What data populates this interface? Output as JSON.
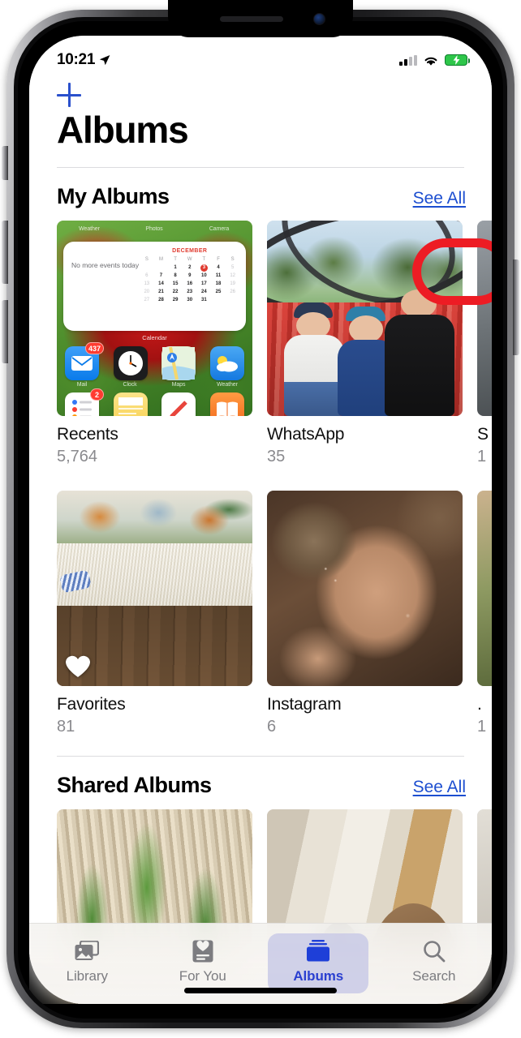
{
  "status_bar": {
    "time": "10:21",
    "location_icon": "location-arrow-icon",
    "cellular_icon": "cellular-signal-icon",
    "wifi_icon": "wifi-icon",
    "battery_icon": "battery-charging-icon"
  },
  "nav": {
    "add_label": "+",
    "add_icon": "plus-icon"
  },
  "header": {
    "title": "Albums"
  },
  "sections": [
    {
      "title": "My Albums",
      "see_all_label": "See All",
      "highlighted": true
    },
    {
      "title": "Shared Albums",
      "see_all_label": "See All",
      "highlighted": false
    }
  ],
  "my_albums": {
    "row1": [
      {
        "name": "Recents",
        "count": "5,764",
        "thumb": "home-screen-screenshot"
      },
      {
        "name": "WhatsApp",
        "count": "35",
        "thumb": "three-people-tulip-garden"
      },
      {
        "name": "S",
        "count": "1",
        "thumb": "partial-photo",
        "partial": true
      }
    ],
    "row2": [
      {
        "name": "Favorites",
        "count": "81",
        "thumb": "dinosaur-fabric-rug-floor",
        "badge_icon": "heart-icon"
      },
      {
        "name": "Instagram",
        "count": "6",
        "thumb": "sepia-closeup"
      },
      {
        "name": ".",
        "count": "1",
        "thumb": "partial-photo",
        "partial": true
      }
    ]
  },
  "shared_albums": [
    {
      "thumb": "garden-mulch-plants"
    },
    {
      "thumb": "indoor-person-doorway"
    },
    {
      "thumb": "partial-photo",
      "partial": true
    }
  ],
  "tabs": [
    {
      "label": "Library",
      "icon": "photo-stack-icon",
      "active": false
    },
    {
      "label": "For You",
      "icon": "heart-card-icon",
      "active": false
    },
    {
      "label": "Albums",
      "icon": "albums-folder-icon",
      "active": true
    },
    {
      "label": "Search",
      "icon": "search-icon",
      "active": false
    }
  ],
  "widget": {
    "events_text": "No more events today",
    "month": "DECEMBER",
    "caption": "Calendar",
    "weekdays": [
      "S",
      "M",
      "T",
      "W",
      "T",
      "F",
      "S"
    ],
    "today": "3"
  },
  "home_screen_icons": {
    "top_labels": [
      "Weather",
      "Photos",
      "Camera"
    ],
    "row_labels": [
      "Mail",
      "Clock",
      "Maps",
      "Weather"
    ],
    "mail_badge": "437",
    "reminders_badge": "2"
  },
  "colors": {
    "link_blue": "#1c4ed0",
    "accent_blue": "#2a50cc",
    "annotation_red": "#ed1c24",
    "tab_active": "#2a3fd0",
    "tab_inactive": "#7c7c80",
    "battery_green": "#2ec64a",
    "secondary_text": "#8a8a8e"
  }
}
